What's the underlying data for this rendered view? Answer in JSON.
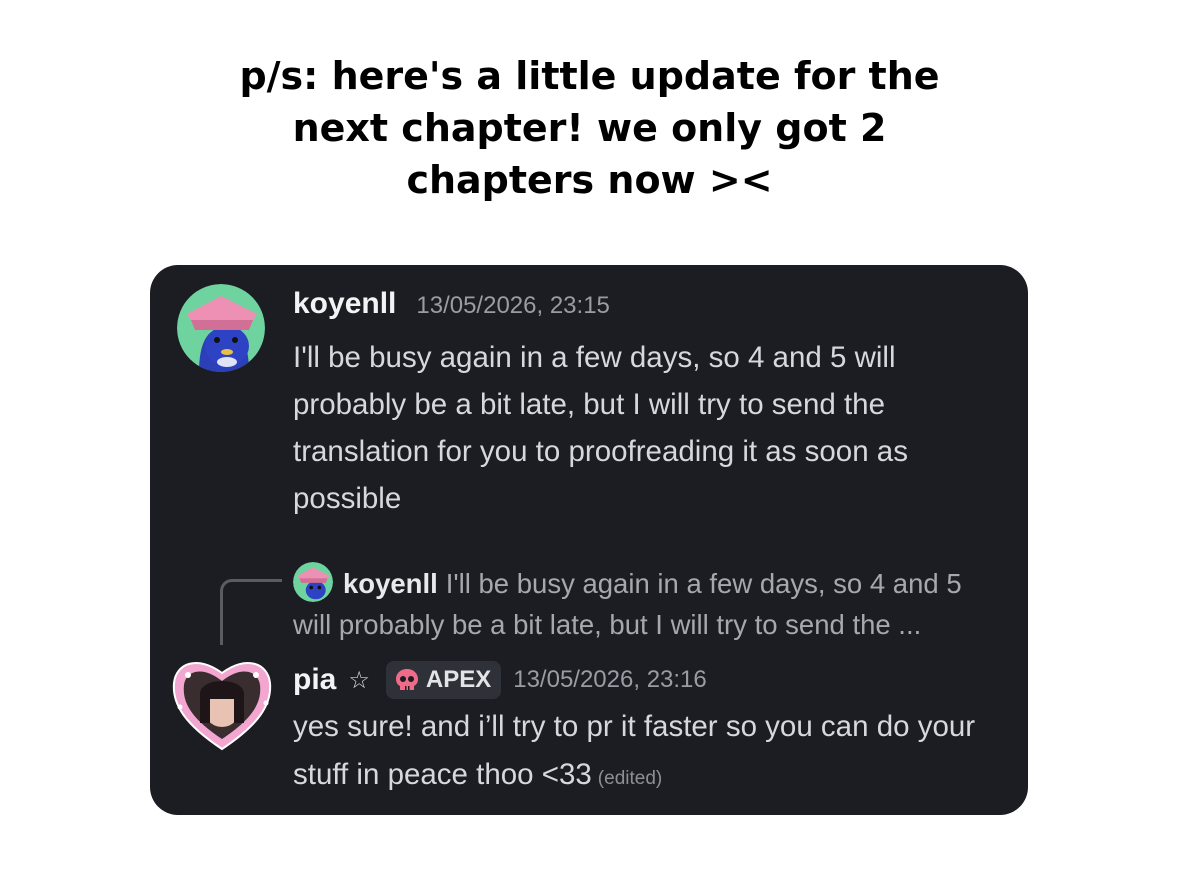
{
  "caption": {
    "lines": [
      "p/s: here's a little update for the",
      "next chapter! we only got 2",
      "chapters now ><"
    ]
  },
  "colors": {
    "card_background": "#1c1d22",
    "username": "#f2f3f5",
    "message_text": "#d6d8dd",
    "timestamp": "#9a9ca4",
    "tag_background": "#2f3138",
    "skull_pink": "#f06a8a"
  },
  "messages": [
    {
      "username": "koyenll",
      "timestamp": "13/05/2026, 23:15",
      "text": "I'll be busy again in a few days, so 4 and 5 will probably be a bit late, but I will try to send the translation for you to proofreading it as soon as possible",
      "avatar_icon": "cartoon-bird-avatar"
    },
    {
      "reply": {
        "username": "koyenll",
        "text": "I'll be busy again in a few days, so 4 and 5 will probably be a bit late, but I will try to send the ...",
        "avatar_icon": "cartoon-bird-avatar"
      },
      "username": "pia",
      "badge_icon": "star-icon",
      "tag": {
        "icon": "skull-icon",
        "label": "APEX"
      },
      "timestamp": "13/05/2026, 23:16",
      "text": "yes sure! and i’ll try to pr it faster so you can do your stuff in peace thoo <33",
      "edited_label": "(edited)",
      "avatar_icon": "heart-frame-avatar"
    }
  ]
}
